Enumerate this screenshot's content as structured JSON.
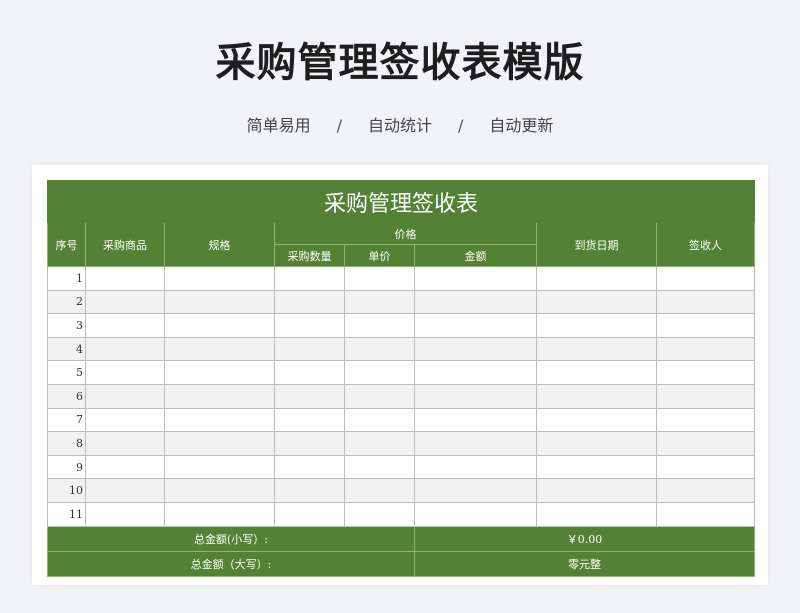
{
  "header": {
    "title": "采购管理签收表模版",
    "taglines": [
      "简单易用",
      "自动统计",
      "自动更新"
    ],
    "separator": "/"
  },
  "sheet": {
    "title": "采购管理签收表",
    "columns": {
      "index": "序号",
      "product": "采购商品",
      "spec": "规格",
      "price_group": "价格",
      "quantity": "采购数量",
      "unit_price": "单价",
      "amount": "金额",
      "arrival_date": "到货日期",
      "signer": "签收人"
    },
    "row_numbers": [
      "1",
      "2",
      "3",
      "4",
      "5",
      "6",
      "7",
      "8",
      "9",
      "10",
      "11"
    ],
    "footer": {
      "total_lower_label": "总金额(小写）:",
      "total_lower_value": "￥0.00",
      "total_upper_label": "总金额（大写）:",
      "total_upper_value": "零元整"
    }
  },
  "colors": {
    "accent": "#548235",
    "row_alt": "#f1f1f1",
    "page_bg": "#f2f3f7"
  }
}
